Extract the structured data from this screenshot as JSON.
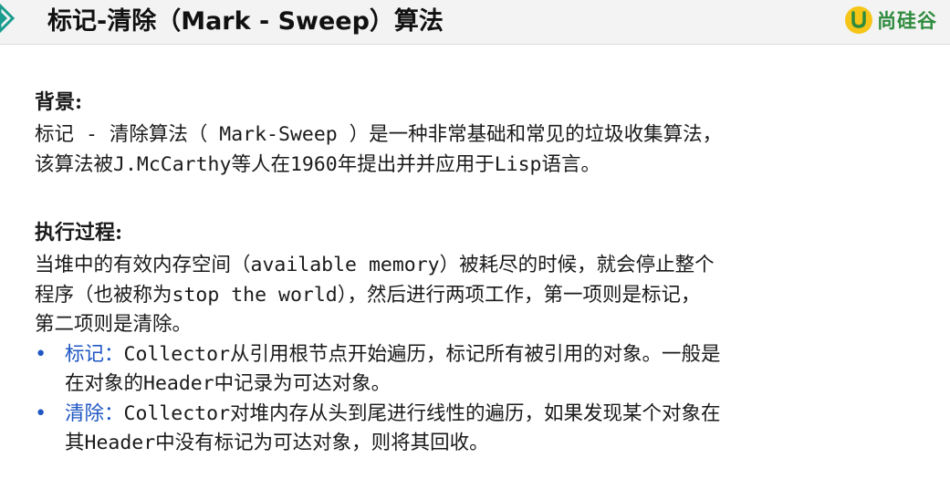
{
  "slide": {
    "title": "标记-清除（Mark - Sweep）算法",
    "brand": "尚硅谷"
  },
  "background_section": {
    "heading": "背景:",
    "lines": [
      "标记 - 清除算法（ Mark-Sweep ）是一种非常基础和常见的垃圾收集算法，",
      "该算法被J.McCarthy等人在1960年提出并并应用于Lisp语言。"
    ]
  },
  "process_section": {
    "heading": "执行过程:",
    "lines": [
      "当堆中的有效内存空间（available memory）被耗尽的时候，就会停止整个",
      "程序（也被称为stop the world），然后进行两项工作，第一项则是标记，",
      "第二项则是清除。"
    ],
    "bullets": [
      {
        "marker": "•",
        "label": "标记：",
        "lines": [
          "Collector从引用根节点开始遍历，标记所有被引用的对象。一般是",
          "在对象的Header中记录为可达对象。"
        ]
      },
      {
        "marker": "•",
        "label": "清除：",
        "lines": [
          "Collector对堆内存从头到尾进行线性的遍历，如果发现某个对象在",
          "其Header中没有标记为可达对象，则将其回收。"
        ]
      }
    ]
  },
  "colors": {
    "accent_blue": "#1f57c3",
    "brand_green": "#2e8b3e",
    "brand_yellow": "#f5c518",
    "corner_teal": "#1a9c8e"
  }
}
